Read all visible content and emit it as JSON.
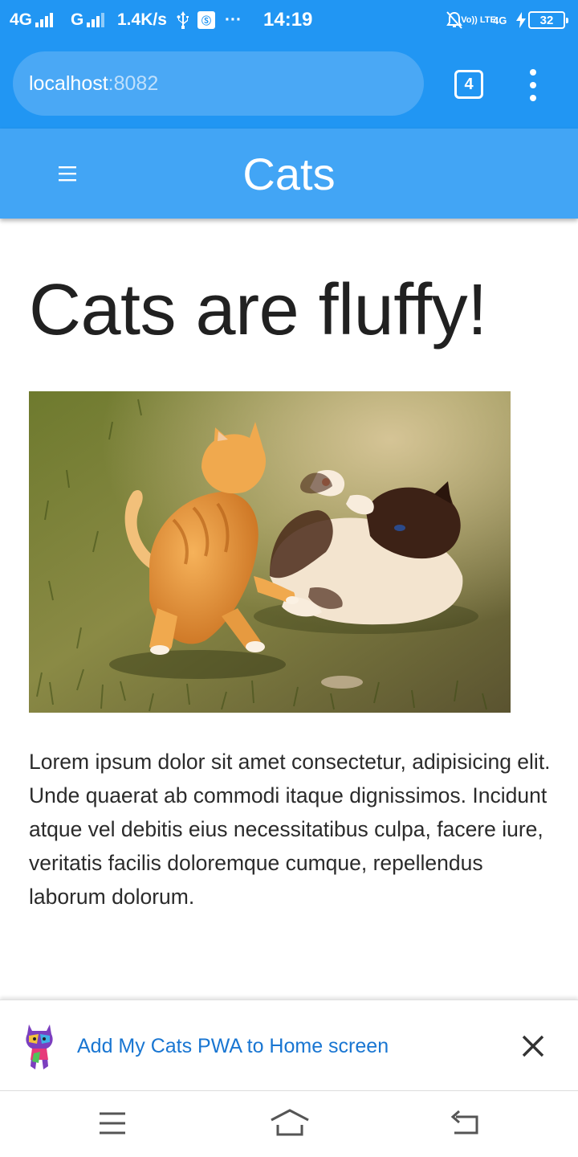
{
  "status_bar": {
    "network_1": "4G",
    "network_2": "G",
    "speed": "1.4K/s",
    "overflow": "···",
    "time": "14:19",
    "volte": "Vo)) LTE",
    "network_3": "4G",
    "battery": "32"
  },
  "browser": {
    "url_host": "localhost",
    "url_port": ":8082",
    "tab_count": "4",
    "icons": {
      "menu": "more-vert-icon"
    }
  },
  "app_header": {
    "menu_glyph": "☰",
    "title": "Cats"
  },
  "content": {
    "headline": "Cats are fluffy!",
    "paragraph": "Lorem ipsum dolor sit amet consectetur, adipisicing elit. Unde quaerat ab commodi itaque dignissimos. Incidunt atque vel debitis eius necessitatibus culpa, facere iure, veritatis facilis doloremque cumque, repellendus laborum dolorum."
  },
  "a2hs_banner": {
    "text": "Add My Cats PWA to Home screen",
    "close_icon": "close-icon"
  },
  "nav_bar": {
    "icons": [
      "menu-icon",
      "home-icon",
      "back-icon"
    ]
  },
  "colors": {
    "browser_blue": "#2196f3",
    "app_bar_blue": "#42a5f5",
    "link_blue": "#1976d2",
    "text_dark": "#212121"
  }
}
